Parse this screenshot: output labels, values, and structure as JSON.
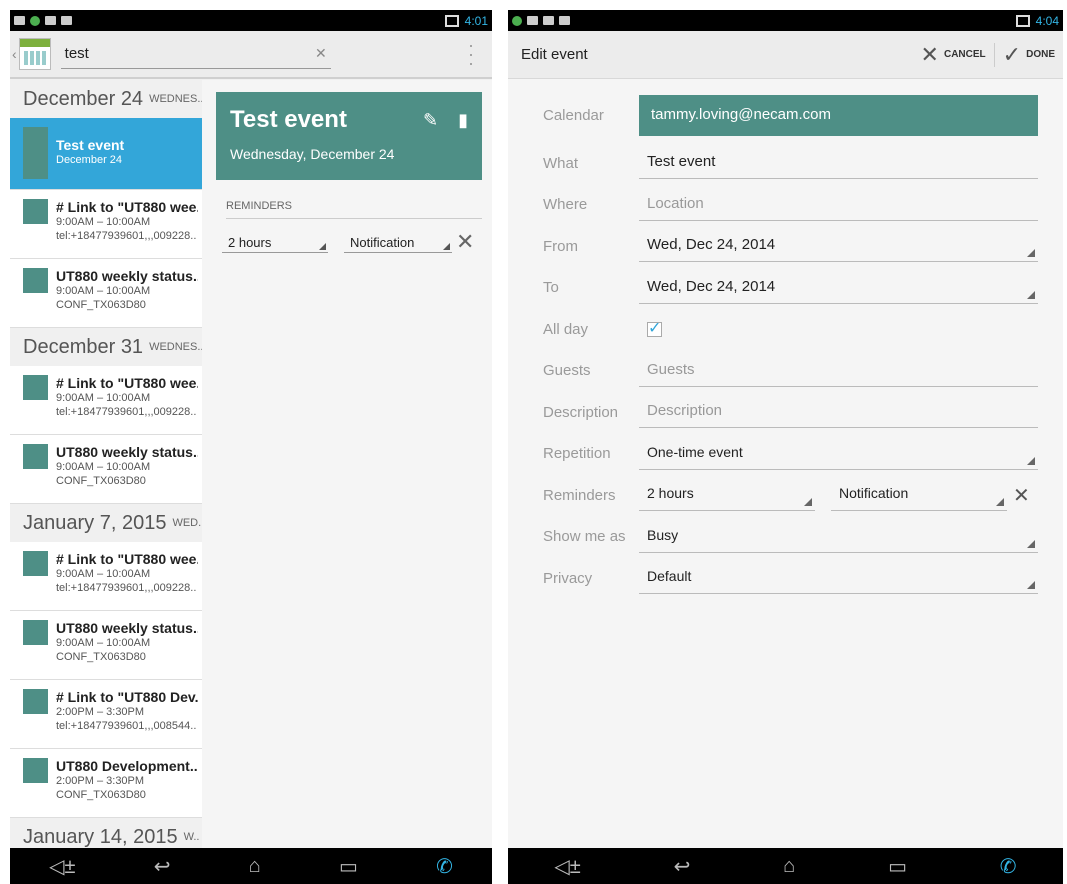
{
  "left": {
    "status_time": "4:01",
    "search_query": "test",
    "agenda": [
      {
        "type": "date",
        "date": "December 24",
        "dow": "WEDNES.."
      },
      {
        "type": "event",
        "selected": true,
        "title": "Test event",
        "lines": [
          "December 24"
        ]
      },
      {
        "type": "event",
        "title": "# Link to \"UT880 wee..",
        "lines": [
          "9:00AM – 10:00AM",
          "tel:+18477939601,,,009228.."
        ]
      },
      {
        "type": "event",
        "title": "UT880 weekly status..",
        "lines": [
          "9:00AM – 10:00AM",
          "CONF_TX063D80"
        ]
      },
      {
        "type": "date",
        "date": "December 31",
        "dow": "WEDNES.."
      },
      {
        "type": "event",
        "title": "# Link to \"UT880 wee..",
        "lines": [
          "9:00AM – 10:00AM",
          "tel:+18477939601,,,009228.."
        ]
      },
      {
        "type": "event",
        "title": "UT880 weekly status..",
        "lines": [
          "9:00AM – 10:00AM",
          "CONF_TX063D80"
        ]
      },
      {
        "type": "date",
        "date": "January 7, 2015",
        "dow": "WED.."
      },
      {
        "type": "event",
        "title": "# Link to \"UT880 wee..",
        "lines": [
          "9:00AM – 10:00AM",
          "tel:+18477939601,,,009228.."
        ]
      },
      {
        "type": "event",
        "title": "UT880 weekly status..",
        "lines": [
          "9:00AM – 10:00AM",
          "CONF_TX063D80"
        ]
      },
      {
        "type": "event",
        "title": "# Link to \"UT880 Dev..",
        "lines": [
          "2:00PM – 3:30PM",
          "tel:+18477939601,,,008544.."
        ]
      },
      {
        "type": "event",
        "title": "UT880 Development..",
        "lines": [
          "2:00PM – 3:30PM",
          "CONF_TX063D80"
        ]
      },
      {
        "type": "date",
        "date": "January 14, 2015",
        "dow": "W.."
      }
    ],
    "detail": {
      "title": "Test event",
      "date": "Wednesday, December 24",
      "reminders_header": "REMINDERS",
      "reminder_time": "2 hours",
      "reminder_method": "Notification"
    }
  },
  "right": {
    "status_time": "4:04",
    "title": "Edit event",
    "cancel": "CANCEL",
    "done": "DONE",
    "fields": {
      "calendar": {
        "label": "Calendar",
        "value": "tammy.loving@necam.com"
      },
      "what": {
        "label": "What",
        "value": "Test event"
      },
      "where": {
        "label": "Where",
        "placeholder": "Location"
      },
      "from": {
        "label": "From",
        "value": "Wed, Dec 24, 2014"
      },
      "to": {
        "label": "To",
        "value": "Wed, Dec 24, 2014"
      },
      "allday": {
        "label": "All day",
        "checked": true
      },
      "guests": {
        "label": "Guests",
        "placeholder": "Guests"
      },
      "description": {
        "label": "Description",
        "placeholder": "Description"
      },
      "repetition": {
        "label": "Repetition",
        "value": "One-time event"
      },
      "reminders": {
        "label": "Reminders",
        "time": "2 hours",
        "method": "Notification"
      },
      "showme": {
        "label": "Show me as",
        "value": "Busy"
      },
      "privacy": {
        "label": "Privacy",
        "value": "Default"
      }
    }
  },
  "icons": {
    "back": "◁±",
    "back2": "↩",
    "home": "⌂",
    "recent": "▭",
    "phone": "✆",
    "check": "✔",
    "pencil": "✎",
    "trash": "🗑"
  },
  "colors": {
    "accent": "#33a6d9",
    "event": "#4e8f86"
  }
}
